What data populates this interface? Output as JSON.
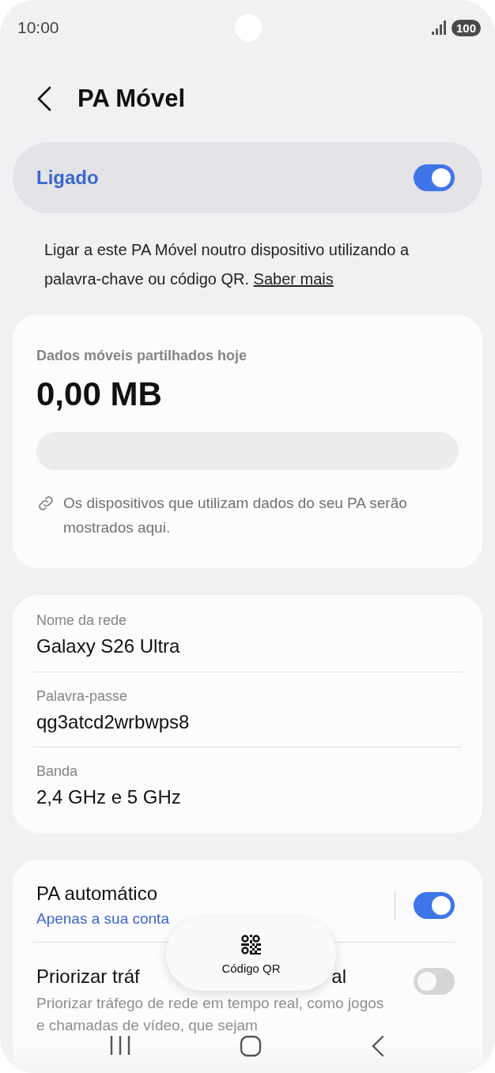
{
  "status_bar": {
    "time": "10:00",
    "battery": "100"
  },
  "header": {
    "title": "PA Móvel"
  },
  "master_switch": {
    "label": "Ligado",
    "on": true
  },
  "intro": {
    "text": "Ligar a este PA Móvel noutro dispositivo utilizando a palavra-chave ou código QR.",
    "link": "Saber mais"
  },
  "usage": {
    "label": "Dados móveis partilhados hoje",
    "amount": "0,00 MB",
    "level": 0,
    "note": "Os dispositivos que utilizam dados do seu PA serão mostrados aqui."
  },
  "network": [
    {
      "label": "Nome da rede",
      "value": "Galaxy S26 Ultra"
    },
    {
      "label": "Palavra-passe",
      "value": "qg3atcd2wrbwps8"
    },
    {
      "label": "Banda",
      "value": "2,4 GHz e 5 GHz"
    }
  ],
  "settings": [
    {
      "kind": "toggle",
      "title": "PA automático",
      "subtitle": "Apenas a sua conta",
      "on": true
    },
    {
      "kind": "toggle",
      "title_parts": [
        "Priorizar tráf",
        "al"
      ],
      "description": "Priorizar tráfego de rede em tempo real, como jogos e chamadas de vídeo, que sejam",
      "on": false
    }
  ],
  "floating_button": {
    "label": "Código QR"
  }
}
